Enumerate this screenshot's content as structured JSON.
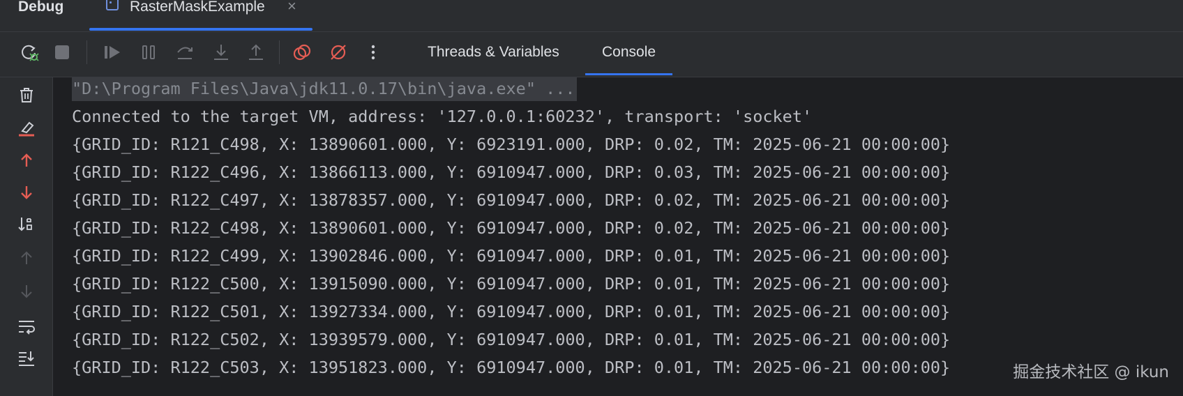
{
  "header": {
    "title": "Debug",
    "session_tab": {
      "label": "RasterMaskExample",
      "close": "×"
    }
  },
  "toolbar": {
    "buttons": [
      {
        "name": "rerun-debug",
        "icon": "rerun-bug-icon"
      },
      {
        "name": "stop",
        "icon": "stop-icon"
      },
      {
        "name": "resume",
        "icon": "resume-icon"
      },
      {
        "name": "pause",
        "icon": "pause-icon"
      },
      {
        "name": "step-over",
        "icon": "step-over-icon"
      },
      {
        "name": "step-into",
        "icon": "step-into-icon"
      },
      {
        "name": "step-out",
        "icon": "step-out-icon"
      },
      {
        "name": "view-breakpoints",
        "icon": "breakpoints-icon"
      },
      {
        "name": "mute-breakpoints",
        "icon": "mute-breakpoints-icon"
      },
      {
        "name": "more",
        "icon": "more-vertical-icon"
      }
    ],
    "tabs": [
      {
        "label": "Threads & Variables",
        "active": false
      },
      {
        "label": "Console",
        "active": true
      }
    ]
  },
  "sidebar": {
    "buttons": [
      {
        "name": "clear-all",
        "icon": "trash-icon"
      },
      {
        "name": "clear-highlight",
        "icon": "eraser-icon"
      },
      {
        "name": "previous-occurrence",
        "icon": "arrow-up-icon"
      },
      {
        "name": "next-occurrence",
        "icon": "arrow-down-icon"
      },
      {
        "name": "sort",
        "icon": "sort-icon"
      },
      {
        "name": "scroll-up",
        "icon": "arrow-up-icon"
      },
      {
        "name": "scroll-down",
        "icon": "arrow-down-icon"
      },
      {
        "name": "soft-wrap",
        "icon": "soft-wrap-icon"
      },
      {
        "name": "scroll-to-end",
        "icon": "scroll-to-end-icon"
      }
    ]
  },
  "console": {
    "lines": [
      "\"D:\\Program Files\\Java\\jdk11.0.17\\bin\\java.exe\" ...",
      "Connected to the target VM, address: '127.0.0.1:60232', transport: 'socket'",
      "{GRID_ID: R121_C498, X: 13890601.000, Y: 6923191.000, DRP: 0.02, TM: 2025-06-21 00:00:00}",
      "{GRID_ID: R122_C496, X: 13866113.000, Y: 6910947.000, DRP: 0.03, TM: 2025-06-21 00:00:00}",
      "{GRID_ID: R122_C497, X: 13878357.000, Y: 6910947.000, DRP: 0.02, TM: 2025-06-21 00:00:00}",
      "{GRID_ID: R122_C498, X: 13890601.000, Y: 6910947.000, DRP: 0.02, TM: 2025-06-21 00:00:00}",
      "{GRID_ID: R122_C499, X: 13902846.000, Y: 6910947.000, DRP: 0.01, TM: 2025-06-21 00:00:00}",
      "{GRID_ID: R122_C500, X: 13915090.000, Y: 6910947.000, DRP: 0.01, TM: 2025-06-21 00:00:00}",
      "{GRID_ID: R122_C501, X: 13927334.000, Y: 6910947.000, DRP: 0.01, TM: 2025-06-21 00:00:00}",
      "{GRID_ID: R122_C502, X: 13939579.000, Y: 6910947.000, DRP: 0.01, TM: 2025-06-21 00:00:00}",
      "{GRID_ID: R122_C503, X: 13951823.000, Y: 6910947.000, DRP: 0.01, TM: 2025-06-21 00:00:00}"
    ]
  },
  "watermark": "掘金技术社区 @ ikun",
  "colors": {
    "background": "#1e1f22",
    "panel": "#2b2d30",
    "accent": "#3574f0",
    "text": "#bcbec4",
    "red_icon": "#e55d54"
  }
}
